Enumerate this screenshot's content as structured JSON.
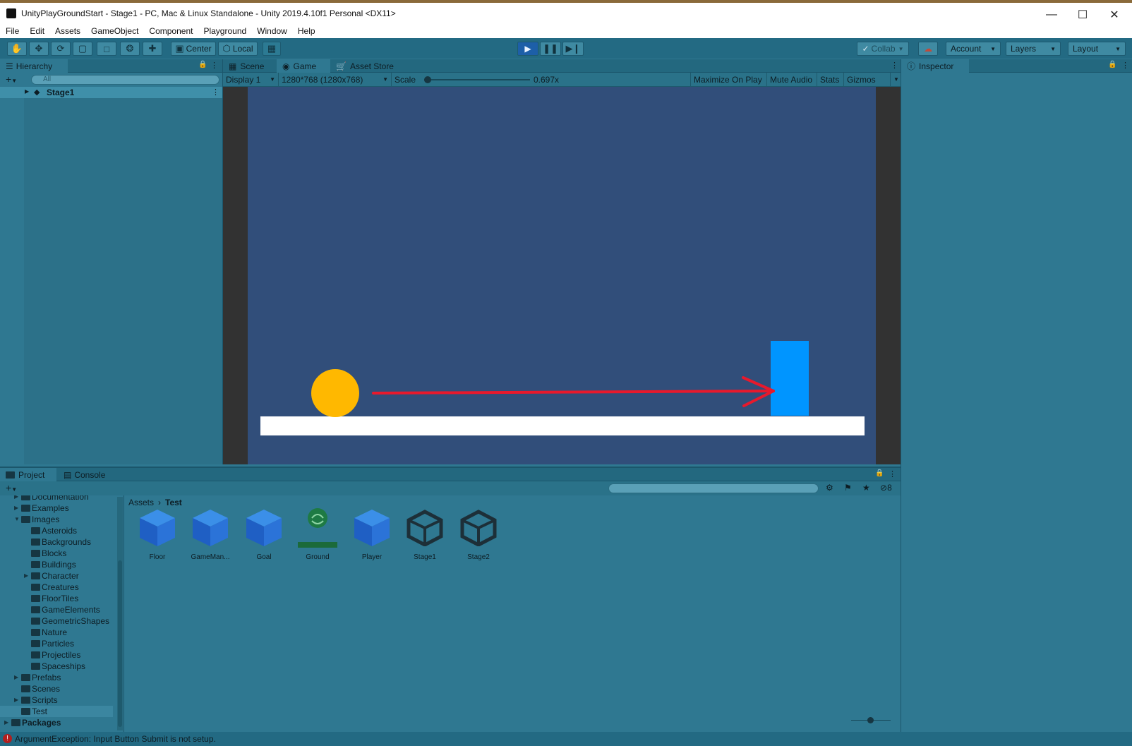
{
  "window": {
    "title": "UnityPlayGroundStart - Stage1 - PC, Mac & Linux Standalone - Unity 2019.4.10f1 Personal <DX11>"
  },
  "menu": [
    "File",
    "Edit",
    "Assets",
    "GameObject",
    "Component",
    "Playground",
    "Window",
    "Help"
  ],
  "toolbar": {
    "pivot": "Center",
    "space": "Local",
    "collab": "Collab",
    "account": "Account",
    "layers": "Layers",
    "layout": "Layout"
  },
  "hierarchy": {
    "tab": "Hierarchy",
    "search_placeholder": "All",
    "scene": "Stage1"
  },
  "center_tabs": [
    "Scene",
    "Game",
    "Asset Store"
  ],
  "game": {
    "display": "Display 1",
    "resolution": "1280*768 (1280x768)",
    "scale_label": "Scale",
    "scale_value": "0.697x",
    "scale_fraction": 0.0,
    "maximize": "Maximize On Play",
    "mute": "Mute Audio",
    "stats": "Stats",
    "gizmos": "Gizmos",
    "colors": {
      "background": "#314e7a",
      "ball": "#ffb800",
      "goal": "#0095ff",
      "ground": "#ffffff",
      "arrow": "#e8192c"
    }
  },
  "inspector": {
    "tab": "Inspector"
  },
  "bottom_tabs": [
    "Project",
    "Console"
  ],
  "project": {
    "hidden_count": "8",
    "tree": [
      {
        "label": "Documentation",
        "indent": 1,
        "arrow": "▶"
      },
      {
        "label": "Examples",
        "indent": 1,
        "arrow": "▶"
      },
      {
        "label": "Images",
        "indent": 1,
        "arrow": "▼"
      },
      {
        "label": "Asteroids",
        "indent": 2,
        "arrow": ""
      },
      {
        "label": "Backgrounds",
        "indent": 2,
        "arrow": ""
      },
      {
        "label": "Blocks",
        "indent": 2,
        "arrow": ""
      },
      {
        "label": "Buildings",
        "indent": 2,
        "arrow": ""
      },
      {
        "label": "Character",
        "indent": 2,
        "arrow": "▶"
      },
      {
        "label": "Creatures",
        "indent": 2,
        "arrow": ""
      },
      {
        "label": "FloorTiles",
        "indent": 2,
        "arrow": ""
      },
      {
        "label": "GameElements",
        "indent": 2,
        "arrow": ""
      },
      {
        "label": "GeometricShapes",
        "indent": 2,
        "arrow": ""
      },
      {
        "label": "Nature",
        "indent": 2,
        "arrow": ""
      },
      {
        "label": "Particles",
        "indent": 2,
        "arrow": ""
      },
      {
        "label": "Projectiles",
        "indent": 2,
        "arrow": ""
      },
      {
        "label": "Spaceships",
        "indent": 2,
        "arrow": ""
      },
      {
        "label": "Prefabs",
        "indent": 1,
        "arrow": "▶"
      },
      {
        "label": "Scenes",
        "indent": 1,
        "arrow": ""
      },
      {
        "label": "Scripts",
        "indent": 1,
        "arrow": "▶"
      },
      {
        "label": "Test",
        "indent": 1,
        "arrow": ""
      },
      {
        "label": "Packages",
        "indent": 0,
        "arrow": "▶"
      }
    ],
    "breadcrumb": [
      "Assets",
      "Test"
    ],
    "assets": [
      {
        "label": "Floor",
        "icon": "prefab-cube-icon"
      },
      {
        "label": "GameMan...",
        "icon": "prefab-cube-icon"
      },
      {
        "label": "Goal",
        "icon": "prefab-cube-icon"
      },
      {
        "label": "Ground",
        "icon": "tilemap-icon"
      },
      {
        "label": "Player",
        "icon": "prefab-cube-icon"
      },
      {
        "label": "Stage1",
        "icon": "unity-scene-icon"
      },
      {
        "label": "Stage2",
        "icon": "unity-scene-icon"
      }
    ]
  },
  "status": {
    "message": "ArgumentException: Input Button Submit is not setup."
  }
}
